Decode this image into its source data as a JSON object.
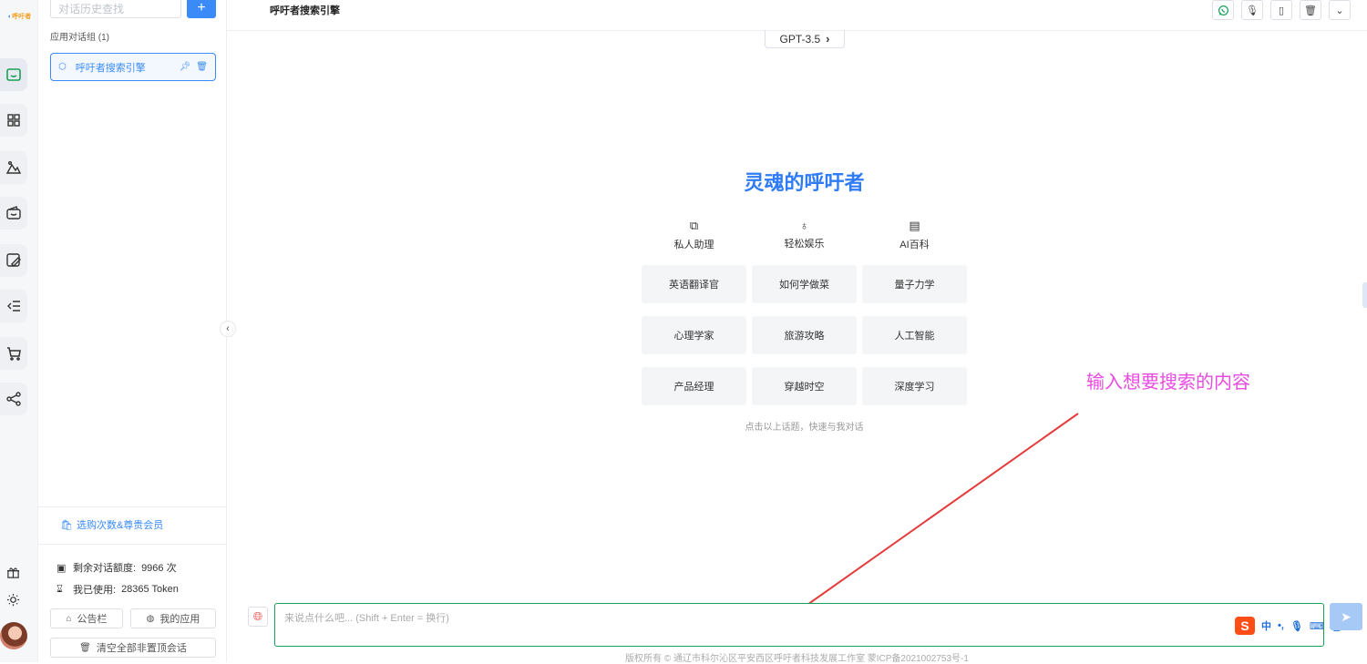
{
  "brand": {
    "logo_text": "呼吁者"
  },
  "sidebar": {
    "search_placeholder": "对话历史查找",
    "add_label": "+",
    "group_title": "应用对话组 (1)",
    "chats": [
      {
        "label": "呼吁者搜索引擎"
      }
    ],
    "buy_link": "选购次数&尊贵会员",
    "quota_remaining_label": "剩余对话额度:",
    "quota_remaining_value": "9966 次",
    "quota_used_label": "我已使用:",
    "quota_used_value": "28365 Token",
    "notice_button": "公告栏",
    "my_apps_button": "我的应用",
    "clear_button": "清空全部非置顶会话"
  },
  "header": {
    "title": "呼吁者搜索引擎"
  },
  "model": {
    "label": "GPT-3.5"
  },
  "welcome": {
    "title": "灵魂的呼吁者",
    "categories": [
      "私人助理",
      "轻松娱乐",
      "AI百科"
    ],
    "topics": [
      [
        "英语翻译官",
        "如何学做菜",
        "量子力学"
      ],
      [
        "心理学家",
        "旅游攻略",
        "人工智能"
      ],
      [
        "产品经理",
        "穿越时空",
        "深度学习"
      ]
    ],
    "hint": "点击以上话题，快速与我对话"
  },
  "annotation": {
    "text": "输入想要搜索的内容",
    "color": "#e84be0"
  },
  "input": {
    "placeholder": "来说点什么吧... (Shift + Enter = 换行)"
  },
  "ime": {
    "lang": "中",
    "punct": "•,"
  },
  "footer": {
    "text": "版权所有 © 通辽市科尔沁区平安西区呼吁者科技发展工作室  蒙ICP备2021002753号-1"
  },
  "colors": {
    "accent": "#3a8af7",
    "input_border": "#18a058",
    "title": "#2f7cf6"
  }
}
